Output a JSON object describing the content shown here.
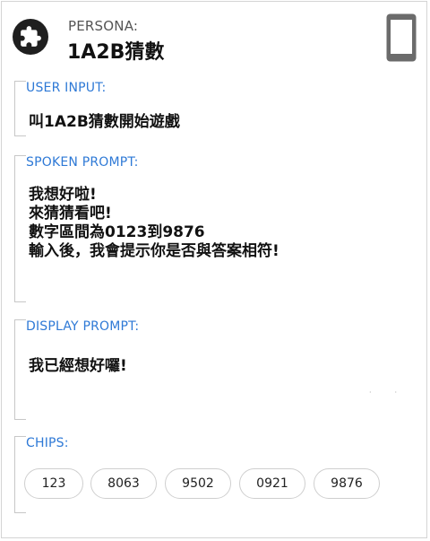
{
  "header": {
    "persona_label": "PERSONA:",
    "persona_name": "1A2B猜數",
    "avatar_icon": "puzzle-icon",
    "device_icon": "phone-icon"
  },
  "sections": {
    "user_input": {
      "label": "USER INPUT:",
      "text": "叫1A2B猜數開始遊戲"
    },
    "spoken_prompt": {
      "label": "SPOKEN PROMPT:",
      "lines": [
        "我想好啦!",
        "來猜猜看吧!",
        "數字區間為0123到9876",
        "輸入後，我會提示你是否與答案相符!"
      ]
    },
    "display_prompt": {
      "label": "DISPLAY PROMPT:",
      "text": "我已經想好囉!"
    },
    "chips": {
      "label": "CHIPS:",
      "items": [
        "123",
        "8063",
        "9502",
        "0921",
        "9876"
      ]
    }
  },
  "colors": {
    "accent": "#2e79d6",
    "border": "#c7c7c7",
    "device": "#6b6b6b"
  }
}
